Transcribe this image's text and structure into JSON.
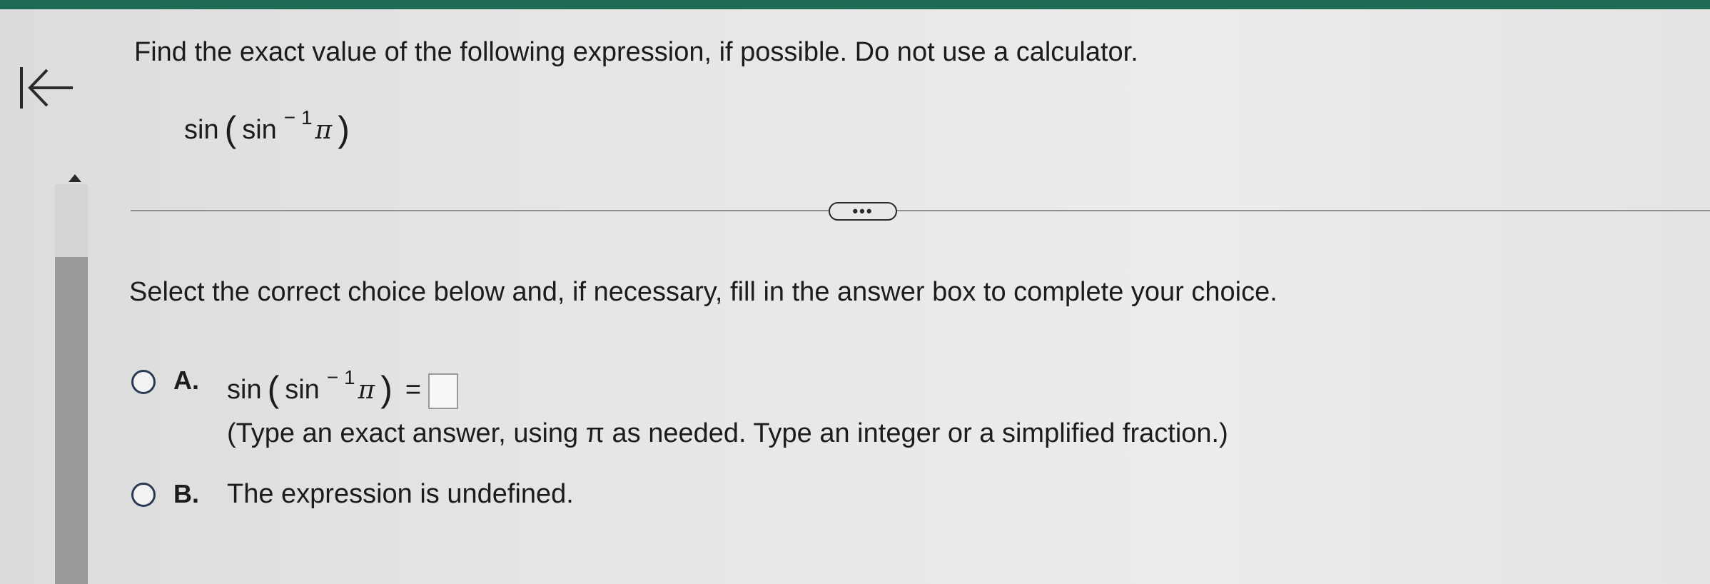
{
  "question": {
    "text": "Find the exact value of the following expression, if possible. Do not use a calculator.",
    "expression": {
      "func": "sin",
      "inner_func": "sin",
      "exponent": "− 1",
      "arg": "π"
    }
  },
  "toolbar": {
    "more_label": "•••"
  },
  "prompt": "Select the correct choice below and, if necessary, fill in the answer box to complete your choice.",
  "choices": [
    {
      "letter": "A.",
      "expression": {
        "func": "sin",
        "inner_func": "sin",
        "exponent": "− 1",
        "arg": "π",
        "equals": "="
      },
      "answer_value": "",
      "hint": "(Type an exact answer, using π as needed. Type an integer or a simplified fraction.)"
    },
    {
      "letter": "B.",
      "text": "The expression is undefined."
    }
  ],
  "colors": {
    "accent_bar": "#1d6b54"
  },
  "icons": {
    "back": "back-to-start-icon",
    "scroll_up": "scroll-up-icon"
  }
}
